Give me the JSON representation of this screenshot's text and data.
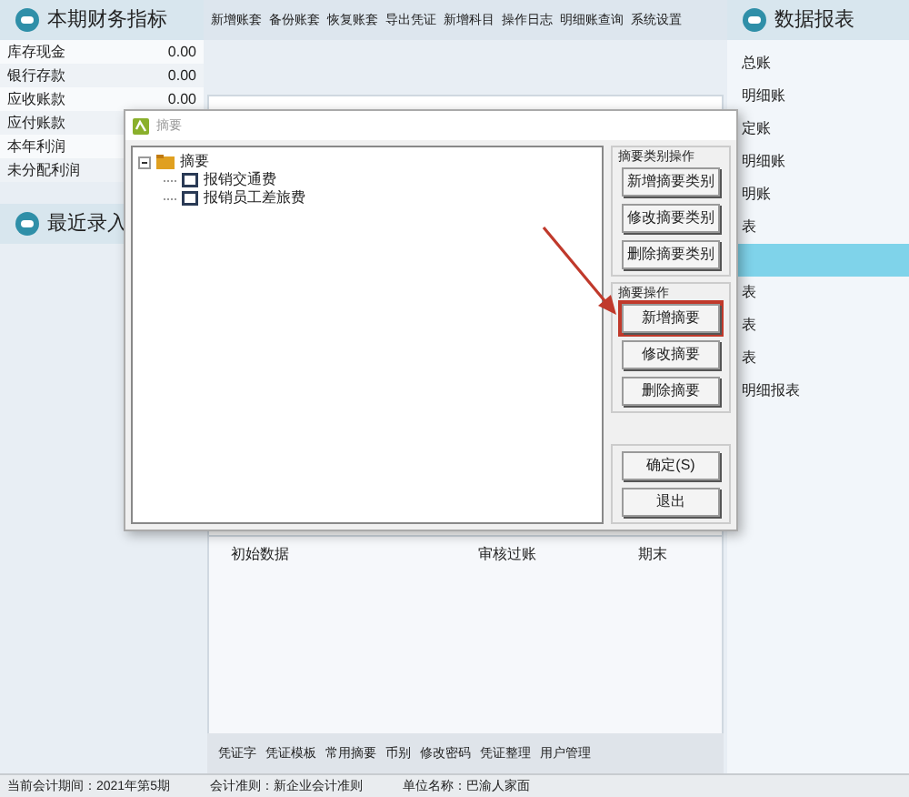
{
  "left_panel": {
    "title": "本期财务指标",
    "rows": [
      {
        "label": "库存现金",
        "value": "0.00"
      },
      {
        "label": "银行存款",
        "value": "0.00"
      },
      {
        "label": "应收账款",
        "value": "0.00"
      },
      {
        "label": "应付账款"
      },
      {
        "label": "本年利润"
      },
      {
        "label": "未分配利润"
      }
    ],
    "recent_title": "最近录入"
  },
  "toolbar": [
    "新增账套",
    "备份账套",
    "恢复账套",
    "导出凭证",
    "新增科目",
    "操作日志",
    "明细账查询",
    "系统设置"
  ],
  "right_panel": {
    "title": "数据报表",
    "items": [
      {
        "label": "总账",
        "selected": false
      },
      {
        "label": "明细账",
        "selected": false
      },
      {
        "label": "定账",
        "selected": false
      },
      {
        "label": "明细账",
        "selected": false
      },
      {
        "label": "明账",
        "selected": false
      },
      {
        "label": "表",
        "selected": false
      },
      {
        "selected": true
      },
      {
        "label": "表",
        "selected": false
      },
      {
        "label": "表",
        "selected": false
      },
      {
        "label": "表",
        "selected": false
      },
      {
        "label": "明细报表",
        "selected": false
      }
    ]
  },
  "dialog": {
    "title": "摘要",
    "tree": [
      {
        "label": "摘要",
        "expanded": true,
        "children": [
          {
            "label": "报销交通费"
          },
          {
            "label": "报销员工差旅费"
          }
        ]
      }
    ],
    "groups": [
      {
        "title": "摘要类别操作",
        "buttons": [
          {
            "label": "新增摘要类别",
            "highlighted": false
          },
          {
            "label": "修改摘要类别",
            "highlighted": false
          },
          {
            "label": "删除摘要类别",
            "highlighted": false
          }
        ]
      },
      {
        "title": "摘要操作",
        "buttons": [
          {
            "label": "新增摘要",
            "highlighted": true
          },
          {
            "label": "修改摘要",
            "highlighted": false
          },
          {
            "label": "删除摘要",
            "highlighted": false
          }
        ]
      }
    ],
    "buttons": [
      "确定(S)",
      "退出"
    ]
  },
  "content_headers": [
    "初始数据",
    "审核过账",
    "期末"
  ],
  "bottom_toolbar": [
    "凭证字",
    "凭证模板",
    "常用摘要",
    "币别",
    "修改密码",
    "凭证整理",
    "用户管理"
  ],
  "status_bar": [
    "当前会计期间：2021年第5期",
    "会计准则：新企业会计准则",
    "单位名称：巴渝人家面"
  ]
}
